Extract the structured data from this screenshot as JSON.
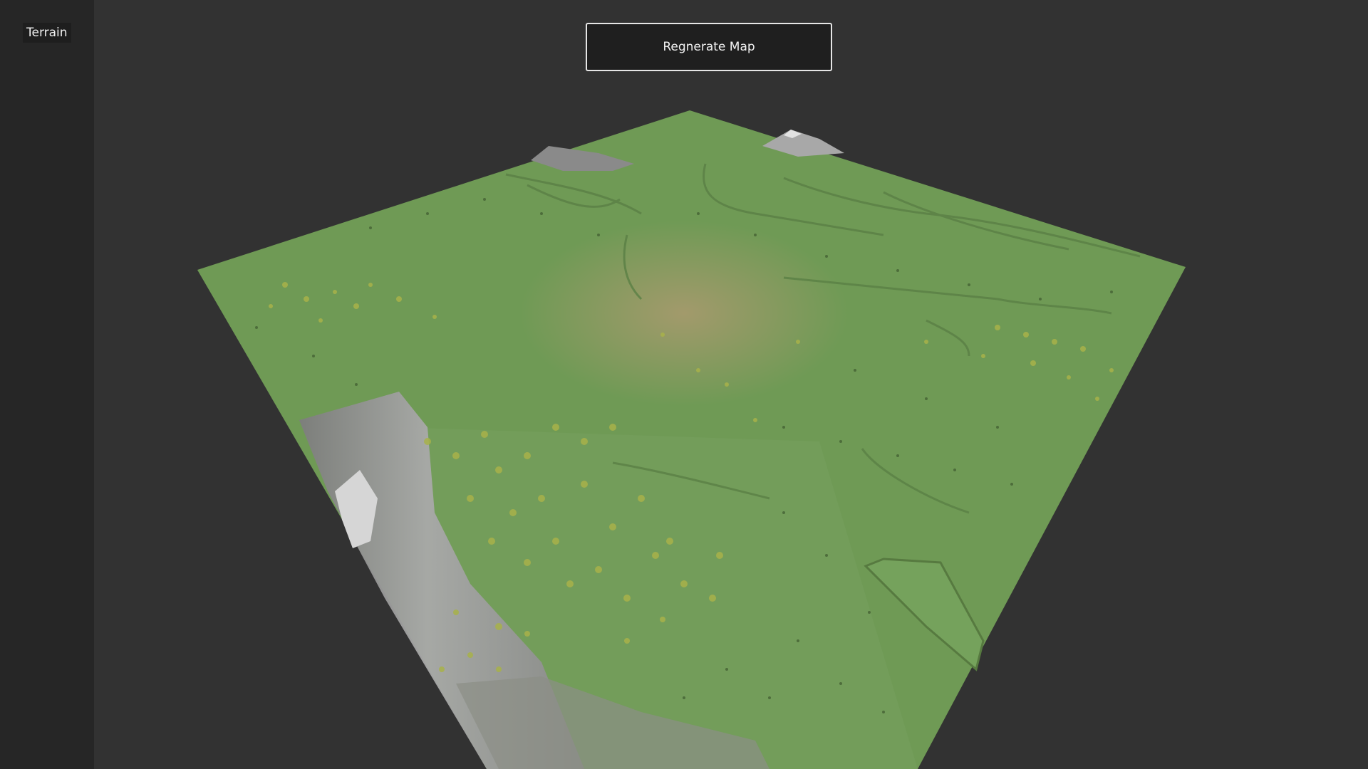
{
  "sidebar": {
    "title": "Terrain"
  },
  "toolbar": {
    "regenerate_label": "Regnerate Map"
  },
  "scene": {
    "background_color": "#323232",
    "grass_color": "#6f9a55",
    "dry_grass_color": "#9c9a6a",
    "rock_color": "#8f8f8f",
    "snow_color": "#d8d8d8",
    "tree_color": "#a8b24a"
  }
}
